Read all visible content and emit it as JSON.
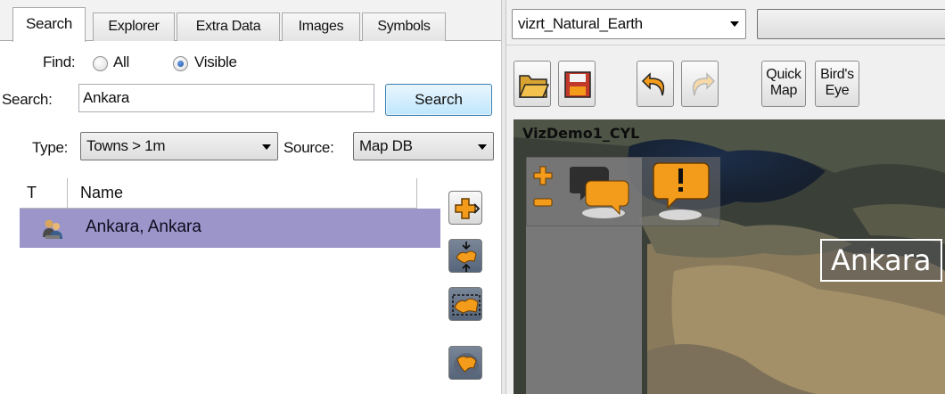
{
  "tabs": [
    {
      "label": "Search",
      "active": true
    },
    {
      "label": "Explorer",
      "active": false
    },
    {
      "label": "Extra Data",
      "active": false
    },
    {
      "label": "Images",
      "active": false
    },
    {
      "label": "Symbols",
      "active": false
    }
  ],
  "search_panel": {
    "find_label": "Find:",
    "find_options": [
      {
        "label": "All",
        "selected": false
      },
      {
        "label": "Visible",
        "selected": true
      }
    ],
    "search_label": "Search:",
    "search_value": "Ankara",
    "search_button": "Search",
    "type_label": "Type:",
    "type_value": "Towns > 1m",
    "source_label": "Source:",
    "source_value": "Map DB"
  },
  "results": {
    "columns": [
      "T",
      "Name"
    ],
    "rows": [
      {
        "icon": "town-person-icon",
        "name": "Ankara, Ankara",
        "selected": true
      }
    ],
    "selected_color": "#9b95c9"
  },
  "side_buttons": [
    "add-icon",
    "fly-to-icon",
    "region-icon",
    "globe-icon"
  ],
  "map_panel": {
    "database_value": "vizrt_Natural_Earth",
    "toolbar": {
      "open_icon": "folder-open-icon",
      "save_icon": "save-icon",
      "undo_icon": "undo-icon",
      "redo_icon": "redo-icon",
      "quick_map_label": "Quick Map",
      "birds_eye_label": "Bird's Eye"
    },
    "map_title": "VizDemo1_CYL",
    "place_label": "Ankara"
  },
  "colors": {
    "accent_orange": "#f39c1b",
    "selection": "#9b95c9",
    "button_blue": "#3c7fb1"
  }
}
